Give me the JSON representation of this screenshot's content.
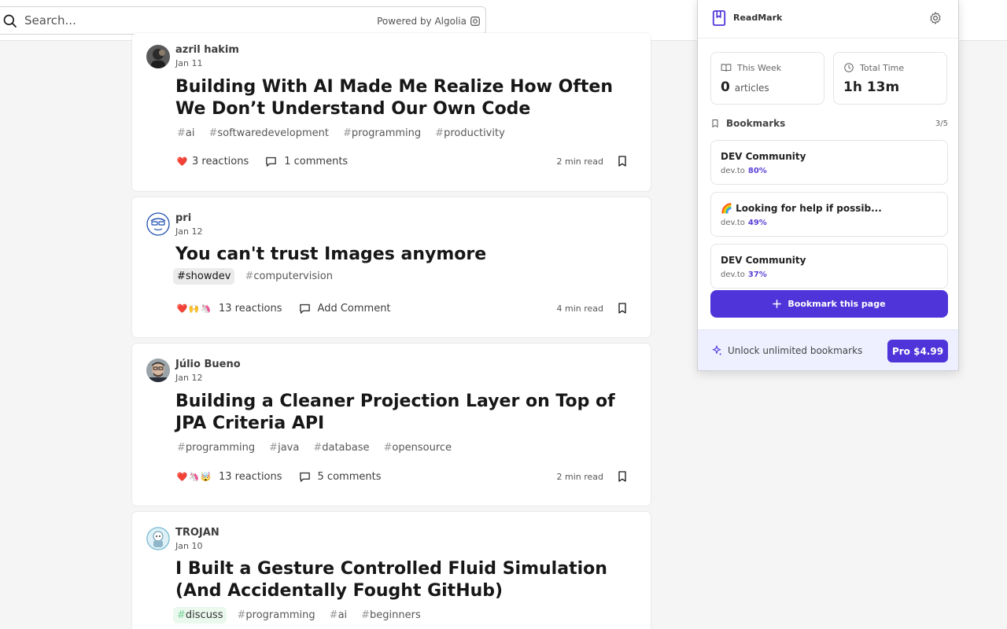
{
  "search": {
    "placeholder": "Search...",
    "powered_by": "Powered by Algolia"
  },
  "feed": {
    "posts": [
      {
        "author": "azril hakim",
        "date": "Jan 11",
        "title": "Building With AI Made Me Realize How Often We Don’t Understand Our Own Code",
        "tags": [
          "ai",
          "softwaredevelopment",
          "programming",
          "productivity"
        ],
        "reactions_label": "3 reactions",
        "comments_label": "1 comments",
        "read_time": "2 min read"
      },
      {
        "author": "pri",
        "date": "Jan 12",
        "title": "You can't trust Images anymore",
        "tags": [
          "showdev",
          "computervision"
        ],
        "reactions_label": "13 reactions",
        "comments_label": "Add Comment",
        "read_time": "4 min read"
      },
      {
        "author": "Júlio Bueno",
        "date": "Jan 12",
        "title": "Building a Cleaner Projection Layer on Top of JPA Criteria API",
        "tags": [
          "programming",
          "java",
          "database",
          "opensource"
        ],
        "reactions_label": "13 reactions",
        "comments_label": "5 comments",
        "read_time": "2 min read"
      },
      {
        "author": "TROJAN",
        "date": "Jan 10",
        "title": "I Built a Gesture Controlled Fluid Simulation (And Accidentally Fought GitHub)",
        "tags": [
          "discuss",
          "programming",
          "ai",
          "beginners"
        ]
      }
    ]
  },
  "popup": {
    "brand": "ReadMark",
    "stats": {
      "this_week_label": "This Week",
      "this_week_value": "0",
      "this_week_unit": "articles",
      "total_time_label": "Total Time",
      "total_time_value": "1h 13m"
    },
    "bookmarks": {
      "title": "Bookmarks",
      "count": "3/5",
      "items": [
        {
          "title": "DEV Community",
          "site": "dev.to",
          "progress": "80%"
        },
        {
          "title": "🌈 Looking for help if possib...",
          "site": "dev.to",
          "progress": "49%"
        },
        {
          "title": "DEV Community",
          "site": "dev.to",
          "progress": "37%"
        }
      ]
    },
    "add_button": "Bookmark this page",
    "upsell": "Unlock unlimited bookmarks",
    "pro_button": "Pro $4.99"
  },
  "colors": {
    "accent": "#4f35d9",
    "progress": "#5b3fd6"
  }
}
